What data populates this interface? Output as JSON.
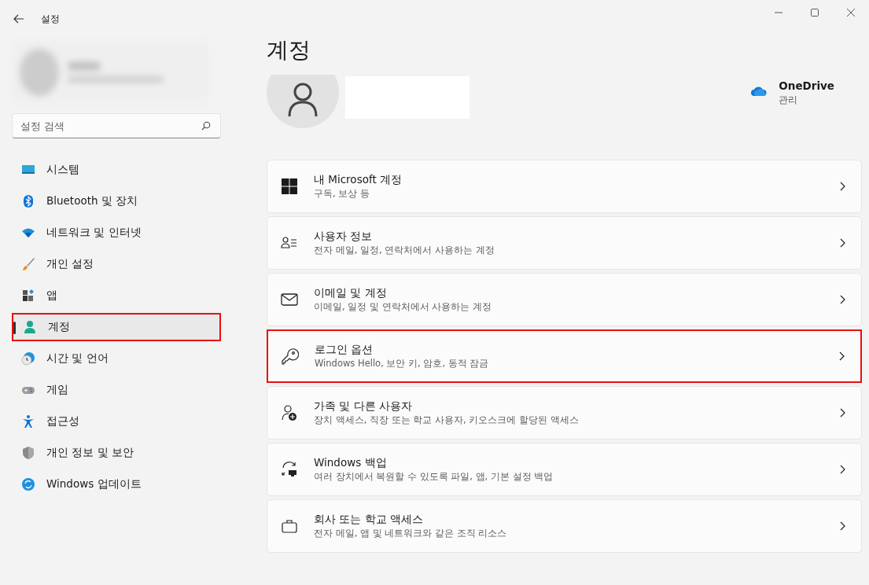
{
  "window": {
    "title": "설정"
  },
  "search": {
    "placeholder": "설정 검색"
  },
  "sidebar": {
    "items": [
      {
        "label": "시스템",
        "selected": false,
        "highlighted": false
      },
      {
        "label": "Bluetooth 및 장치",
        "selected": false,
        "highlighted": false
      },
      {
        "label": "네트워크 및 인터넷",
        "selected": false,
        "highlighted": false
      },
      {
        "label": "개인 설정",
        "selected": false,
        "highlighted": false
      },
      {
        "label": "앱",
        "selected": false,
        "highlighted": false
      },
      {
        "label": "계정",
        "selected": true,
        "highlighted": true
      },
      {
        "label": "시간 및 언어",
        "selected": false,
        "highlighted": false
      },
      {
        "label": "게임",
        "selected": false,
        "highlighted": false
      },
      {
        "label": "접근성",
        "selected": false,
        "highlighted": false
      },
      {
        "label": "개인 정보 및 보안",
        "selected": false,
        "highlighted": false
      },
      {
        "label": "Windows 업데이트",
        "selected": false,
        "highlighted": false
      }
    ]
  },
  "page": {
    "title": "계정"
  },
  "onedrive": {
    "title": "OneDrive",
    "action": "관리"
  },
  "cards": [
    {
      "title": "내 Microsoft 계정",
      "subtitle": "구독, 보상 등",
      "highlighted": false
    },
    {
      "title": "사용자 정보",
      "subtitle": "전자 메일, 일정, 연락처에서 사용하는 계정",
      "highlighted": false
    },
    {
      "title": "이메일 및 계정",
      "subtitle": "이메일, 일정 및 연락처에서 사용하는 계정",
      "highlighted": false
    },
    {
      "title": "로그인 옵션",
      "subtitle": "Windows Hello, 보안 키, 암호, 동적 잠금",
      "highlighted": true
    },
    {
      "title": "가족 및 다른 사용자",
      "subtitle": "장치 액세스, 직장 또는 학교 사용자, 키오스크에 할당된 액세스",
      "highlighted": false
    },
    {
      "title": "Windows 백업",
      "subtitle": "여러 장치에서 복원할 수 있도록 파일, 앱, 기본 설정 백업",
      "highlighted": false
    },
    {
      "title": "회사 또는 학교 액세스",
      "subtitle": "전자 메일, 앱 및 네트워크와 같은 조직 리소스",
      "highlighted": false
    }
  ]
}
